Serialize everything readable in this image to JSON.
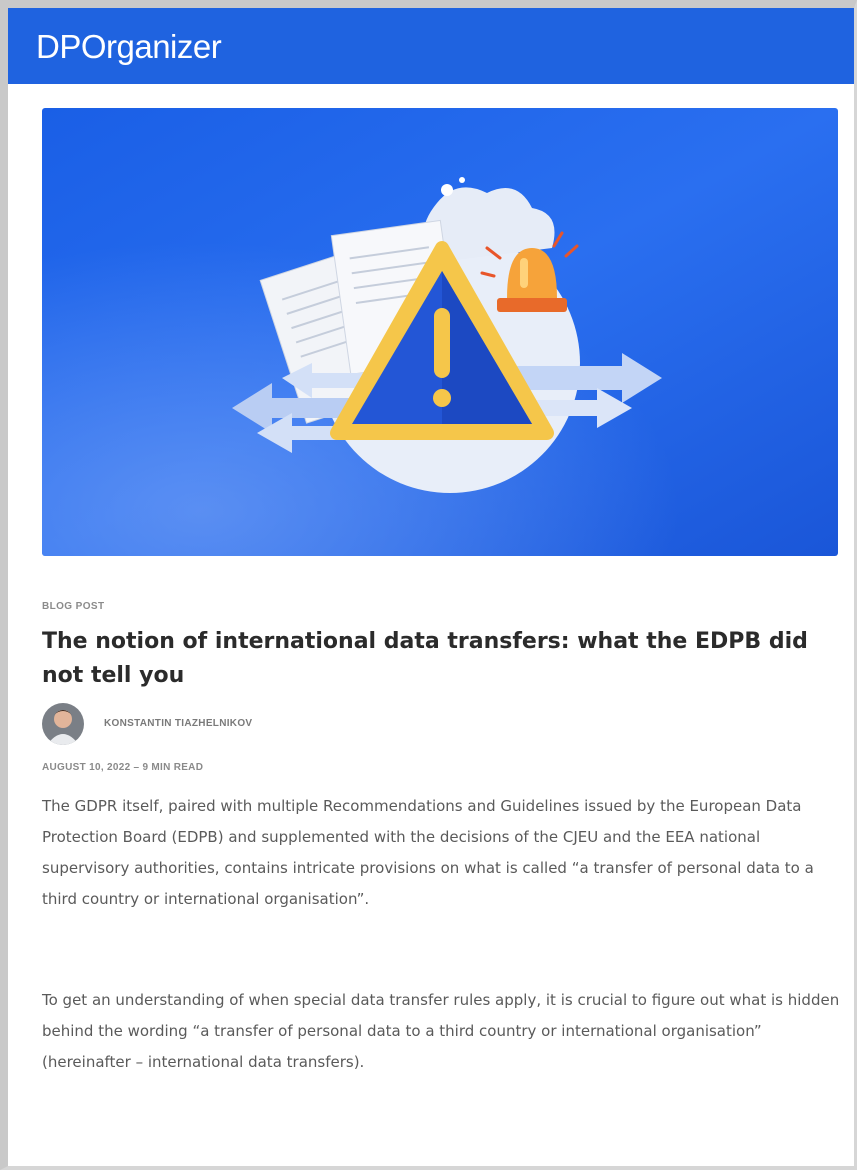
{
  "header": {
    "brand": "DPOrganizer"
  },
  "hero": {
    "bg_color": "#1f63e0",
    "accent_color": "#f5c64a",
    "image_description_icon": "warning-triangle-illustration"
  },
  "post": {
    "kicker": "BLOG POST",
    "title": "The notion of international data transfers: what the EDPB did not tell you",
    "author": "KONSTANTIN TIAZHELNIKOV",
    "meta": "AUGUST 10, 2022 – 9 MIN READ",
    "paragraphs": [
      "The GDPR itself, paired with multiple Recommendations and Guidelines issued by the European Data Protection Board (EDPB) and supplemented with the decisions of the CJEU and the EEA national supervisory authorities, contains intricate provisions on what is called “a transfer of personal data to a third country or international organisation”.",
      "To get an understanding of when special data transfer rules apply, it is crucial to figure out what is hidden behind the wording “a transfer of personal data to a third country or international organisation” (hereinafter – international data transfers)."
    ]
  }
}
